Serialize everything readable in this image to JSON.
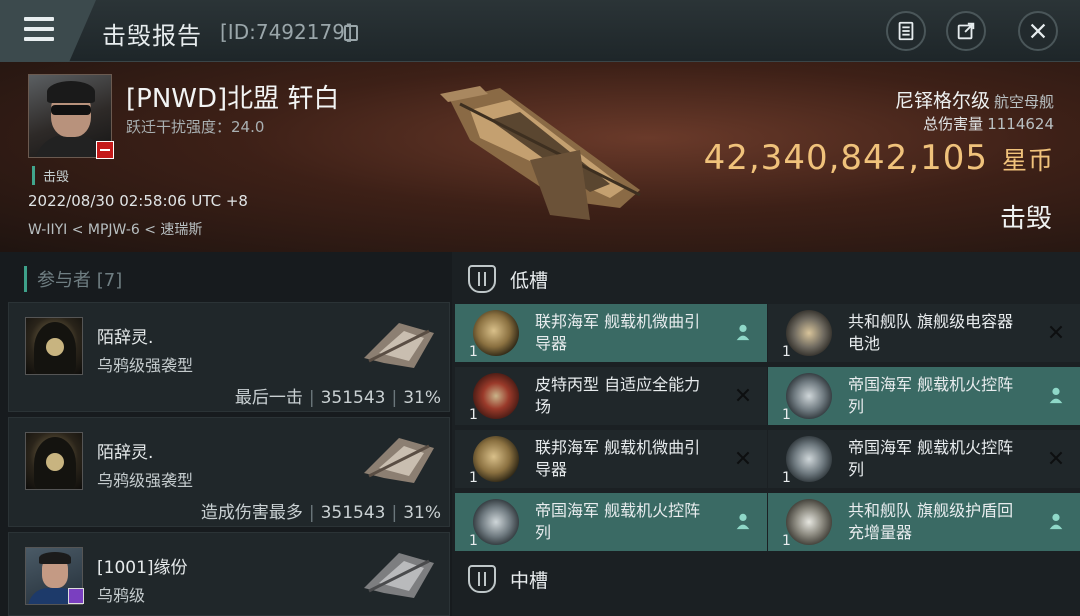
{
  "header": {
    "title": "击毁报告",
    "report_id": "[ID:7492179]"
  },
  "victim": {
    "name": "[PNWD]北盟 轩白",
    "warp_scram": "跃迁干扰强度：24.0",
    "status_tag": "击毁",
    "time": "2022/08/30 02:58:06 UTC +8",
    "location": "W-IIYI < MPJW-6 < 速瑞斯",
    "ship_class": "尼铎格尔级",
    "ship_type": "航空母舰",
    "total_damage_label": "总伤害量",
    "total_damage": "1114624",
    "isk_value": "42,340,842,105",
    "isk_unit": "星币",
    "result": "击毁"
  },
  "participants": {
    "header": "参与者 [7]",
    "items": [
      {
        "name": "陌辞灵.",
        "ship": "乌鸦级强袭型",
        "role": "最后一击",
        "damage": "351543",
        "percent": "31%"
      },
      {
        "name": "陌辞灵.",
        "ship": "乌鸦级强袭型",
        "role": "造成伤害最多",
        "damage": "351543",
        "percent": "31%"
      },
      {
        "name": "[1001]缘份",
        "ship": "乌鸦级",
        "role": "",
        "damage": "",
        "percent": ""
      }
    ]
  },
  "fitting": {
    "low_slot_title": "低槽",
    "mid_slot_title": "中槽",
    "low_slots": [
      {
        "label": "联邦海军 舰载机微曲引导器",
        "qty": "1",
        "state": "dropped",
        "icon": "dish-icon"
      },
      {
        "label": "共和舰队 旗舰级电容器电池",
        "qty": "1",
        "state": "destroyed",
        "icon": "battery-icon"
      },
      {
        "label": "皮特丙型 自适应全能力场",
        "qty": "1",
        "state": "destroyed",
        "icon": "shield-icon"
      },
      {
        "label": "帝国海军 舰载机火控阵列",
        "qty": "1",
        "state": "dropped",
        "icon": "jet-icon"
      },
      {
        "label": "联邦海军 舰载机微曲引导器",
        "qty": "1",
        "state": "destroyed",
        "icon": "dish-icon"
      },
      {
        "label": "帝国海军 舰载机火控阵列",
        "qty": "1",
        "state": "destroyed",
        "icon": "jet-icon"
      },
      {
        "label": "帝国海军 舰载机火控阵列",
        "qty": "1",
        "state": "dropped",
        "icon": "jet-icon"
      },
      {
        "label": "共和舰队 旗舰级护盾回充增量器",
        "qty": "1",
        "state": "dropped",
        "icon": "shield-icon"
      }
    ]
  },
  "colors": {
    "accent_teal": "#3ea18a",
    "isk_gold": "#f0c27b",
    "highlight_row": "#3a6a64"
  }
}
